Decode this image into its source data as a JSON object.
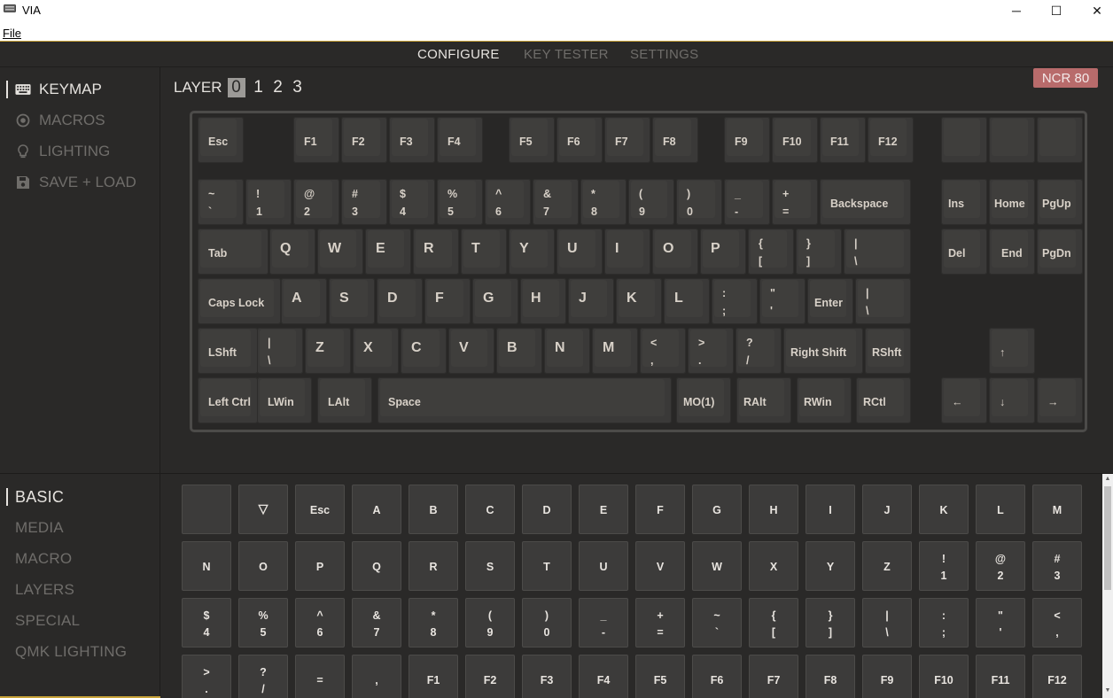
{
  "window": {
    "title": "VIA",
    "minimize": "─",
    "maximize": "☐",
    "close": "✕"
  },
  "menu": {
    "file": "File"
  },
  "nav": {
    "tabs": [
      {
        "label": "CONFIGURE"
      },
      {
        "label": "KEY TESTER"
      },
      {
        "label": "SETTINGS"
      }
    ],
    "active": "CONFIGURE"
  },
  "sidebar": {
    "items": [
      {
        "label": "KEYMAP",
        "icon": "keyboard-icon"
      },
      {
        "label": "MACROS",
        "icon": "record-icon"
      },
      {
        "label": "LIGHTING",
        "icon": "lightbulb-icon"
      },
      {
        "label": "SAVE + LOAD",
        "icon": "save-icon"
      }
    ]
  },
  "layers": {
    "label": "LAYER",
    "items": [
      "0",
      "1",
      "2",
      "3"
    ],
    "selected": "0"
  },
  "keyboard": {
    "name": "NCR 80"
  },
  "categories": {
    "items": [
      "BASIC",
      "MEDIA",
      "MACRO",
      "LAYERS",
      "SPECIAL",
      "QMK LIGHTING"
    ],
    "active": "BASIC"
  },
  "colors": {
    "background": "#2a2928",
    "accent": "#c9a43a",
    "badge": "#b86b6b",
    "text": "#e6e3df",
    "muted": "#6f6d6a"
  }
}
